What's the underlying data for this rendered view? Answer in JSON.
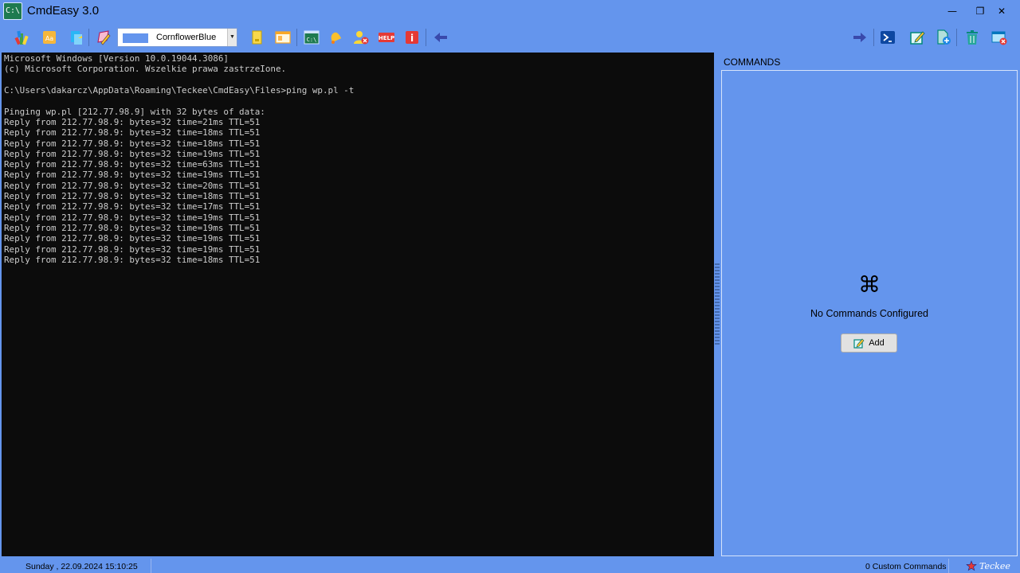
{
  "window": {
    "title": "CmdEasy 3.0",
    "app_icon_text": "C:\\",
    "minimize_glyph": "—",
    "maximize_glyph": "❐",
    "close_glyph": "✕"
  },
  "toolbar": {
    "left_icons": [
      "palette-icon",
      "font-icon",
      "copy-icon",
      "theme-icon"
    ],
    "color_selector": {
      "value": "CornflowerBlue",
      "swatch_color": "#6495ED",
      "arrow": "▼"
    },
    "mid_icons": [
      "note-icon",
      "window-icon",
      "cmd-icon",
      "bell-icon",
      "remove-user-icon",
      "help-icon",
      "info-icon",
      "back-arrow-icon"
    ],
    "help_text": "HELP",
    "info_text": "i",
    "right_icons": [
      "forward-arrow-icon",
      "powershell-icon",
      "edit-icon",
      "new-file-icon",
      "trash-icon",
      "window-close-icon"
    ]
  },
  "console": {
    "lines": [
      "Microsoft Windows [Version 10.0.19044.3086]",
      "(c) Microsoft Corporation. Wszelkie prawa zastrzeIone.",
      "",
      "C:\\Users\\dakarcz\\AppData\\Roaming\\Teckee\\CmdEasy\\Files>ping wp.pl -t",
      "",
      "Pinging wp.pl [212.77.98.9] with 32 bytes of data:",
      "Reply from 212.77.98.9: bytes=32 time=21ms TTL=51",
      "Reply from 212.77.98.9: bytes=32 time=18ms TTL=51",
      "Reply from 212.77.98.9: bytes=32 time=18ms TTL=51",
      "Reply from 212.77.98.9: bytes=32 time=19ms TTL=51",
      "Reply from 212.77.98.9: bytes=32 time=63ms TTL=51",
      "Reply from 212.77.98.9: bytes=32 time=19ms TTL=51",
      "Reply from 212.77.98.9: bytes=32 time=20ms TTL=51",
      "Reply from 212.77.98.9: bytes=32 time=18ms TTL=51",
      "Reply from 212.77.98.9: bytes=32 time=17ms TTL=51",
      "Reply from 212.77.98.9: bytes=32 time=19ms TTL=51",
      "Reply from 212.77.98.9: bytes=32 time=19ms TTL=51",
      "Reply from 212.77.98.9: bytes=32 time=19ms TTL=51",
      "Reply from 212.77.98.9: bytes=32 time=19ms TTL=51",
      "Reply from 212.77.98.9: bytes=32 time=18ms TTL=51"
    ]
  },
  "commands": {
    "header": "COMMANDS",
    "icon_glyph": "⌘",
    "empty_message": "No Commands Configured",
    "add_label": "Add"
  },
  "statusbar": {
    "date": "Sunday , 22.09.2024 15:10:25",
    "count": "0 Custom Commands",
    "brand": "Teckee"
  },
  "colors": {
    "background": "#6495ED",
    "console_bg": "#0c0c0c",
    "console_text": "#cccccc"
  }
}
